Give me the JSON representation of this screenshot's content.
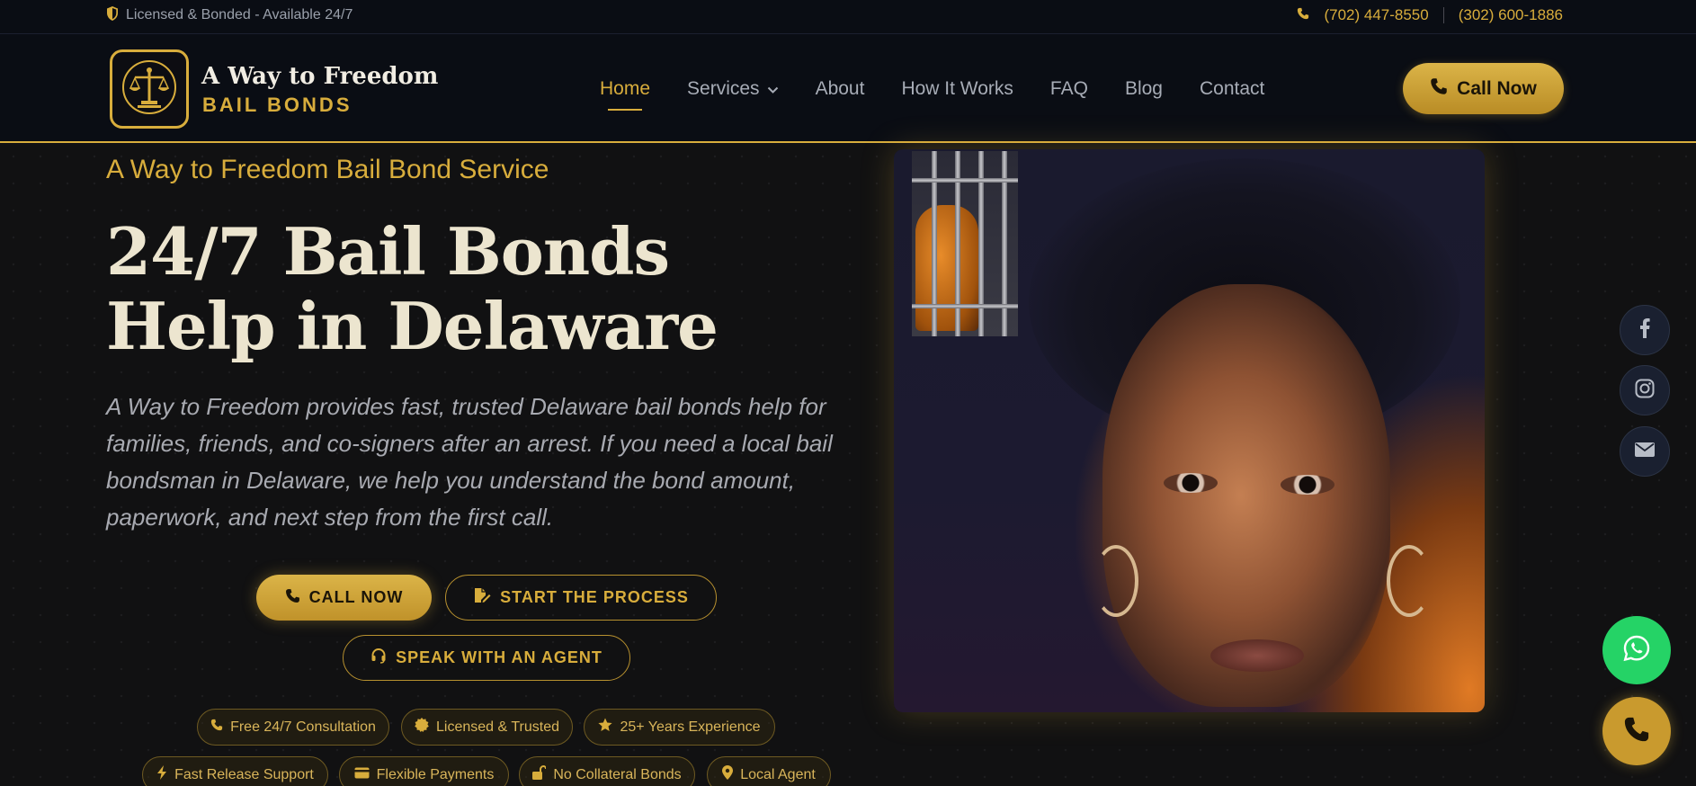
{
  "topbar": {
    "badge_text": "Licensed & Bonded - Available 24/7",
    "phone_1": "(702) 447-8550",
    "phone_2": "(302) 600-1886",
    "icons": [
      "shield-icon",
      "phone-icon"
    ]
  },
  "brand": {
    "title": "A Way to Freedom",
    "subtitle": "BAIL BONDS",
    "logo_icon": "scales-of-justice-icon",
    "accent_color": "#d8ad3c"
  },
  "nav": {
    "items": [
      {
        "label": "Home",
        "active": true
      },
      {
        "label": "Services",
        "has_dropdown": true
      },
      {
        "label": "About"
      },
      {
        "label": "How It Works"
      },
      {
        "label": "FAQ"
      },
      {
        "label": "Blog"
      },
      {
        "label": "Contact"
      }
    ],
    "cta_label": "Call Now"
  },
  "hero": {
    "eyebrow": "A Way to Freedom Bail Bond Service",
    "heading": "24/7 Bail Bonds Help in Delaware",
    "lede": "A Way to Freedom provides fast, trusted Delaware bail bonds help for families, friends, and co-signers after an arrest. If you need a local bail bondsman in Delaware, we help you understand the bond amount, paperwork, and next step from the first call.",
    "buttons": {
      "call_now": "CALL NOW",
      "start_process": "START THE PROCESS",
      "speak_agent": "SPEAK WITH AN AGENT"
    },
    "features": [
      {
        "label": "Free 24/7 Consultation",
        "icon": "phone-icon"
      },
      {
        "label": "Licensed & Trusted",
        "icon": "certificate-icon"
      },
      {
        "label": "25+ Years Experience",
        "icon": "star-icon"
      },
      {
        "label": "Fast Release Support",
        "icon": "bolt-icon"
      },
      {
        "label": "Flexible Payments",
        "icon": "credit-card-icon"
      },
      {
        "label": "No Collateral Bonds",
        "icon": "unlock-icon"
      },
      {
        "label": "Local Agent",
        "icon": "map-pin-icon"
      }
    ]
  },
  "social": {
    "items": [
      "facebook-icon",
      "instagram-icon",
      "envelope-icon"
    ]
  },
  "floating": {
    "whatsapp_color": "#25d366",
    "call_color": "#c99a2e"
  }
}
